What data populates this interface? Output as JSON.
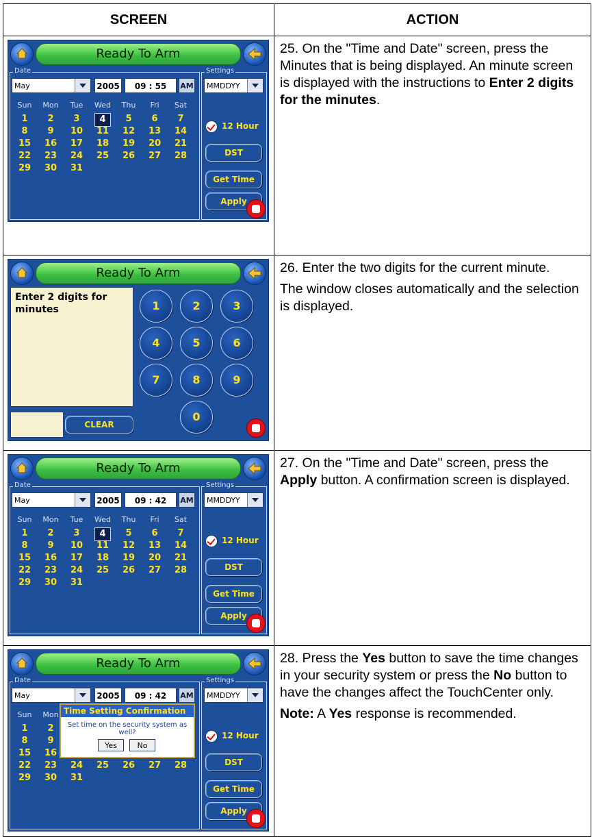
{
  "header": {
    "screen": "SCREEN",
    "action": "ACTION"
  },
  "device": {
    "status": "Ready To Arm",
    "date_group": "Date",
    "settings_group": "Settings",
    "month": "May",
    "year": "2005",
    "ampm": "AM",
    "format": "MMDDYY",
    "hour_mode": "12 Hour",
    "dst_button": "DST",
    "get_time_button": "Get Time",
    "apply_button": "Apply",
    "weekdays": [
      "Sun",
      "Mon",
      "Tue",
      "Wed",
      "Thu",
      "Fri",
      "Sat"
    ],
    "weeks": [
      [
        "1",
        "2",
        "3",
        "4",
        "5",
        "6",
        "7"
      ],
      [
        "8",
        "9",
        "10",
        "11",
        "12",
        "13",
        "14"
      ],
      [
        "15",
        "16",
        "17",
        "18",
        "19",
        "20",
        "21"
      ],
      [
        "22",
        "23",
        "24",
        "25",
        "26",
        "27",
        "28"
      ],
      [
        "29",
        "30",
        "31",
        "",
        "",
        "",
        ""
      ]
    ],
    "selected_day": "4",
    "hour_colon": ":"
  },
  "rows": [
    {
      "time": "09 : 55",
      "action_html": [
        "25. On the \"Time and Date\" screen, press the Minutes that is being displayed.  An minute screen is displayed with the instructions to ",
        "Enter 2 digits for the minutes",
        "."
      ]
    },
    {
      "keypad_prompt": "Enter 2 digits for minutes",
      "keys": [
        "1",
        "2",
        "3",
        "4",
        "5",
        "6",
        "7",
        "8",
        "9",
        "0"
      ],
      "clear_button": "CLEAR",
      "action_p1": "26. Enter the two digits for the current minute.",
      "action_p2": "The window closes automatically and the selection is displayed."
    },
    {
      "time": "09 : 42",
      "action_a": "27. On the \"Time and Date\" screen, press the ",
      "action_b": "Apply",
      "action_c": " button.  A confirmation screen is displayed."
    },
    {
      "time": "09 : 42",
      "dialog_title": "Time Setting Confirmation",
      "dialog_text": "Set time on the security system as well?",
      "yes_button": "Yes",
      "no_button": "No",
      "action_a": "28. Press the ",
      "action_b": "Yes",
      "action_c": " button to save the time changes in your security system or press the ",
      "action_d": "No",
      "action_e": " button to have the changes affect the TouchCenter only.",
      "note_label": "Note:",
      "note_a": " A ",
      "note_b": "Yes",
      "note_c": " response is recommended."
    }
  ]
}
